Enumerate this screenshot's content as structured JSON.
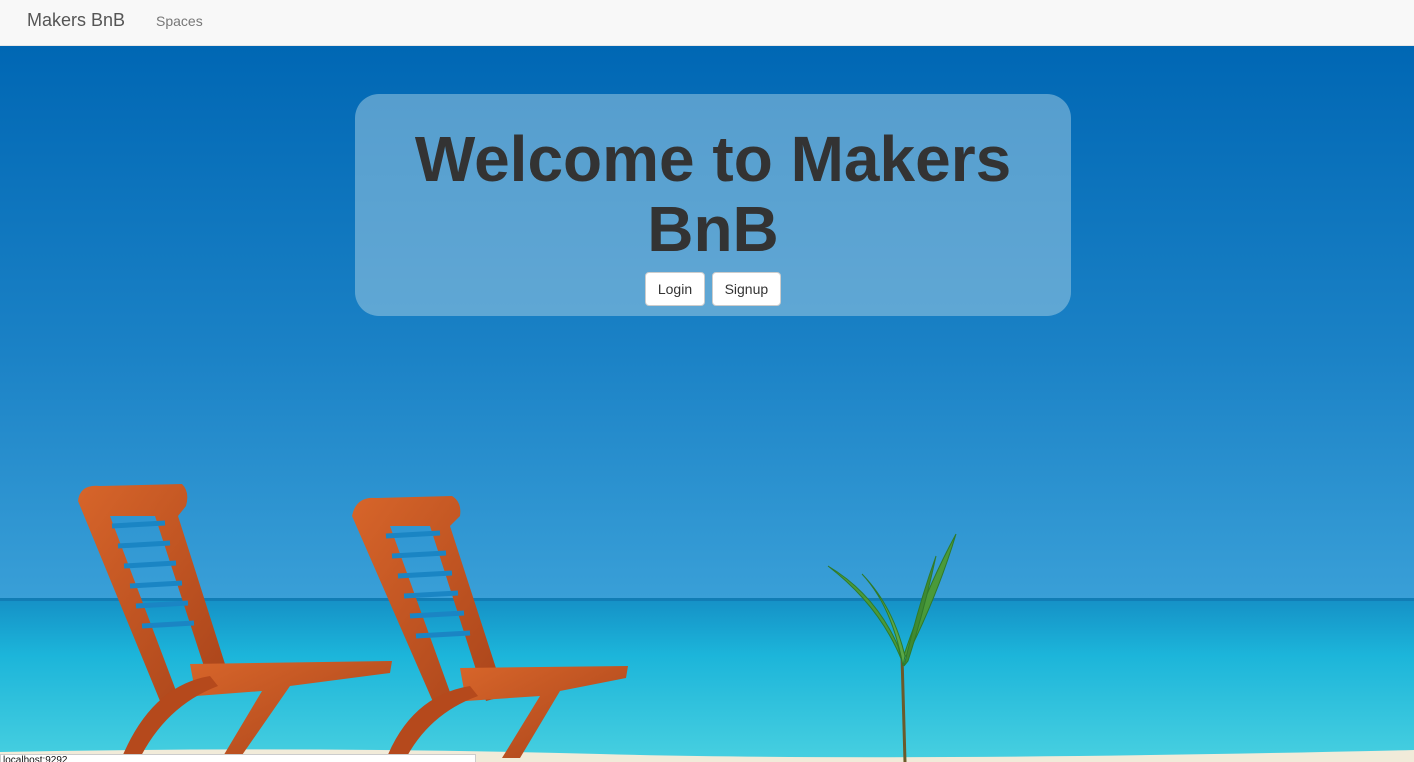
{
  "navbar": {
    "brand": "Makers BnB",
    "links": [
      {
        "label": "Spaces"
      }
    ]
  },
  "hero": {
    "title": "Welcome to Makers BnB",
    "buttons": [
      {
        "label": "Login"
      },
      {
        "label": "Signup"
      }
    ]
  },
  "status_bar": {
    "url": "localhost:9292"
  },
  "colors": {
    "sky_top": "#0066b3",
    "sky_bottom": "#2f98d3",
    "sea": "#20b8d8",
    "chair": "#c9541e",
    "navbar_bg": "#f8f8f8"
  },
  "background_image": "beach-with-two-wooden-deck-chairs-and-palm-sprout"
}
